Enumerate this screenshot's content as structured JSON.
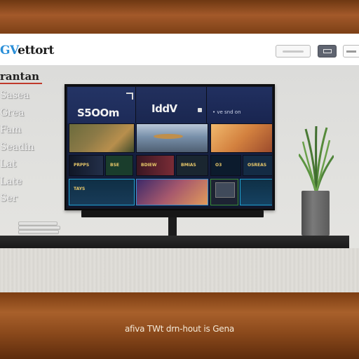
{
  "header": {
    "logo_accent": "GV",
    "logo_text": "ettort",
    "buttons": [
      "",
      "",
      ""
    ]
  },
  "sidebar": {
    "title": "rantan",
    "items": [
      "Sasea",
      "Grea",
      "Fam",
      "Seadin",
      "Lat",
      "Late",
      "Ser"
    ]
  },
  "tv": {
    "pane_a_text": "S5OOm",
    "pane_b_text": "IddV",
    "pane_c_text": "• ve snd on",
    "row2_labels": [
      "PRPPS",
      "BSE",
      "BDIEW",
      "BMIAS",
      "O3",
      "OSREAS"
    ],
    "row3_labels": [
      "TAYS",
      "",
      "",
      ""
    ]
  },
  "caption": "afiva TWt drn-hout is Gena",
  "colors": {
    "accent": "#2a8fd8",
    "wood": "#a3592a",
    "header_bg": "#ffffff",
    "screen_bg": "#1c2b55"
  }
}
